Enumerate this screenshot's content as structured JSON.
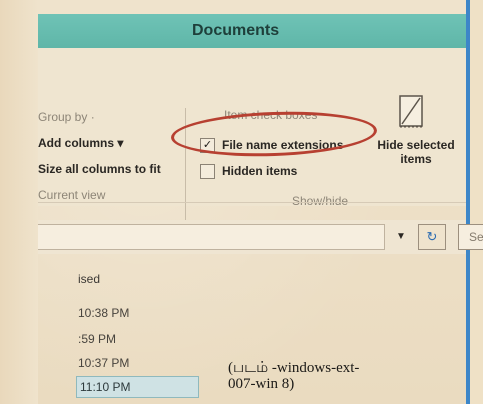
{
  "window": {
    "title": "Documents"
  },
  "ribbon": {
    "layout_group": {
      "group_by": "Group by ·",
      "add_columns": "Add columns ▾",
      "size_all_columns": "Size all columns to fit",
      "footer": "Current view"
    },
    "show_hide_group": {
      "item_check_boxes": "Item check boxes",
      "file_name_extensions": {
        "label": "File name extensions",
        "checked": true
      },
      "hidden_items": {
        "label": "Hidden items",
        "checked": false
      },
      "hide_selected_items": "Hide selected items",
      "footer": "Show/hide"
    }
  },
  "address_bar": {
    "refresh_icon": "refresh-icon",
    "search_placeholder": "Sea"
  },
  "file_list": {
    "column_header": "ised",
    "rows": [
      {
        "time": "10:38 PM"
      },
      {
        "time": ":59 PM"
      },
      {
        "time": "10:37 PM"
      },
      {
        "time": "11:10 PM",
        "selected": true
      }
    ]
  },
  "caption": {
    "line1": "(படம் -windows-ext-",
    "line2": "007-win 8)"
  },
  "colors": {
    "title_bar": "#5fb6a8",
    "highlight_circle": "#b74031",
    "window_border": "#3d86c8",
    "selected_row": "#cfe2e4"
  }
}
